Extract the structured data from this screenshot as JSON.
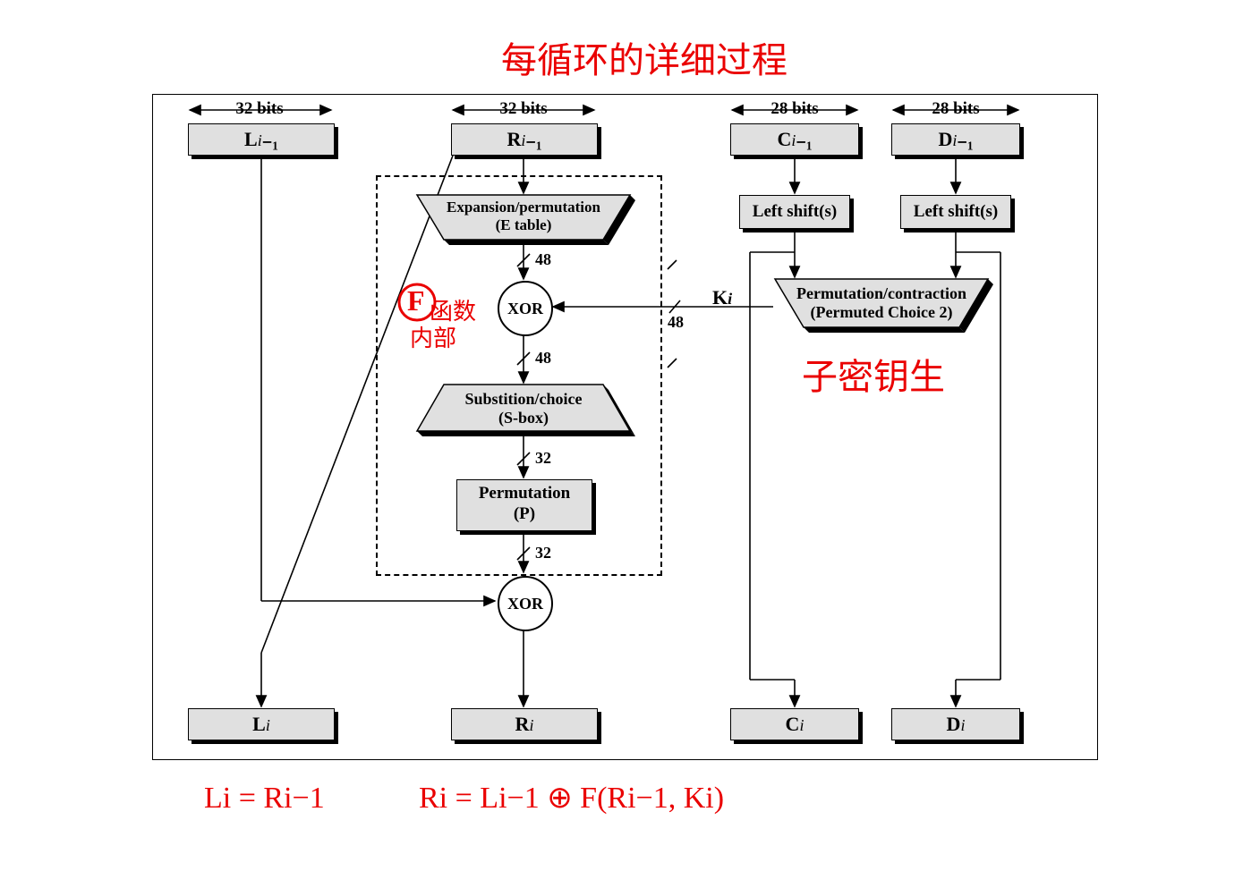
{
  "title_annotation": "每循环的详细过程",
  "bits": {
    "b32": "32 bits",
    "b28": "28 bits"
  },
  "blocks": {
    "L_in": "Lᵢ₋₁",
    "R_in": "Rᵢ₋₁",
    "C_in": "Cᵢ₋₁",
    "D_in": "Dᵢ₋₁",
    "L_out": "Lᵢ",
    "R_out": "Rᵢ",
    "C_out": "Cᵢ",
    "D_out": "Dᵢ",
    "leftshift": "Left shift(s)",
    "expansion_l1": "Expansion/permutation",
    "expansion_l2": "(E table)",
    "sbox_l1": "Substition/choice",
    "sbox_l2": "(S-box)",
    "perm_l1": "Permutation",
    "perm_l2": "(P)",
    "pc2_l1": "Permutation/contraction",
    "pc2_l2": "(Permuted Choice 2)"
  },
  "ops": {
    "xor": "XOR"
  },
  "wires": {
    "w48": "48",
    "w32": "32",
    "Ki": "Kᵢ"
  },
  "annotations": {
    "F": "F",
    "F_sub1": "函数",
    "F_sub2": "内部",
    "subkey": "子密钥生",
    "eq_L": "Li = Ri−1",
    "eq_R": "Ri = Li−1 ⊕ F(Ri−1, Ki)"
  }
}
